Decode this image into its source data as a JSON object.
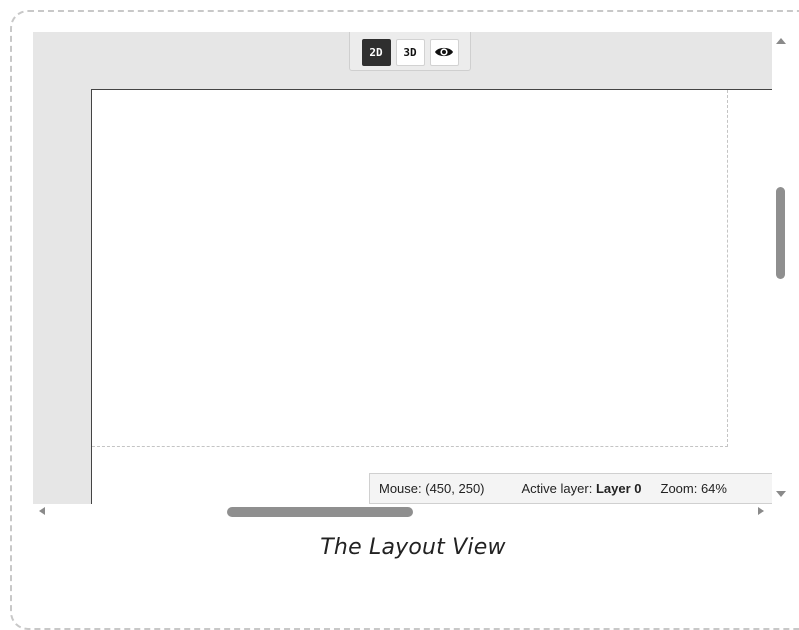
{
  "toolbar": {
    "btn_2d_label": "2D",
    "btn_3d_label": "3D",
    "preview_icon": "eye-icon",
    "active_mode": "2D"
  },
  "status": {
    "mouse": "Mouse: (450, 250)",
    "layer_prefix": "Active layer:",
    "layer_name": "Layer 0",
    "zoom": "Zoom: 64%"
  },
  "caption": "The Layout View"
}
